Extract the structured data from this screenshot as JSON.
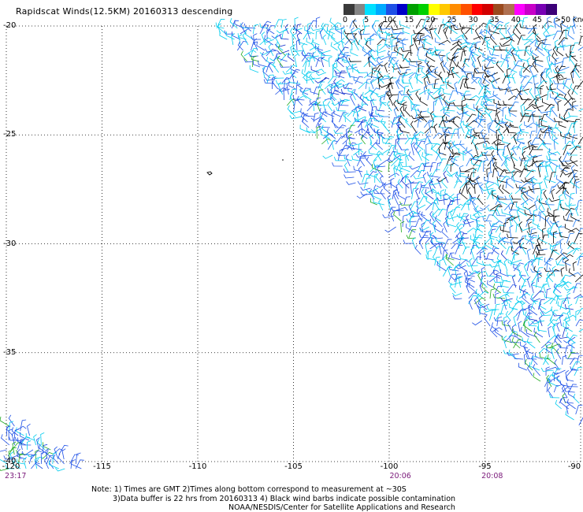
{
  "title": "Rapidscat Winds(12.5KM) 20160313 descending",
  "legend": {
    "colors": [
      "#3a3a3a",
      "#858585",
      "#00e0ff",
      "#00aaff",
      "#1e50e6",
      "#0000c8",
      "#00a000",
      "#00d000",
      "#ffff00",
      "#ffc800",
      "#ff8c00",
      "#ff5000",
      "#ff0000",
      "#d20000",
      "#9a4a1e",
      "#b07050",
      "#ff00ff",
      "#c800c8",
      "#7800b4",
      "#3c0078"
    ],
    "labels": [
      "0",
      "5",
      "10",
      "15",
      "20",
      "25",
      "30",
      "35",
      "40",
      "45",
      ">50 knots"
    ]
  },
  "map": {
    "lat_ticks": [
      "-20",
      "-25",
      "-30",
      "-35",
      "-40"
    ],
    "lon_ticks": [
      "-120",
      "-115",
      "-110",
      "-105",
      "-100",
      "-95",
      "-90"
    ],
    "time_labels": [
      {
        "text": "23:17",
        "lon": -119.6
      },
      {
        "text": "20:06",
        "lon": -99.5
      },
      {
        "text": "20:08",
        "lon": -94.7
      }
    ]
  },
  "notes": [
    "Note: 1) Times are GMT 2)Times along bottom correspond to measurement at ~30S",
    "3)Data buffer is 22 hrs from 20160313 4) Black wind barbs indicate possible contamination",
    "NOAA/NESDIS/Center for Satellite Applications and Research"
  ]
}
